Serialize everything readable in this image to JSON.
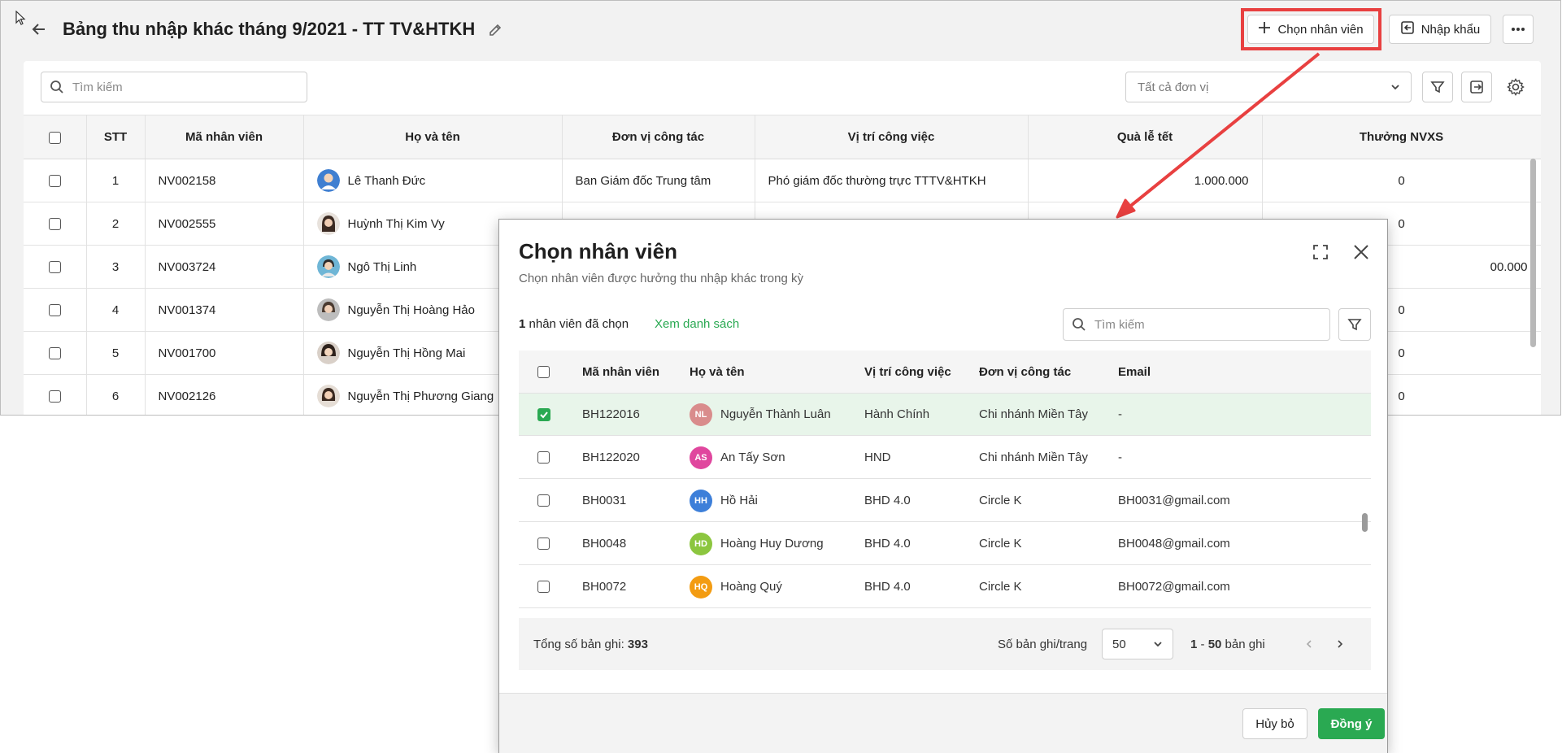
{
  "header": {
    "title": "Bảng thu nhập khác tháng 9/2021 - TT TV&HTKH",
    "choose_employee_label": "Chọn nhân viên",
    "import_label": "Nhập khẩu"
  },
  "toolbar": {
    "search_placeholder": "Tìm kiếm",
    "unit_select_value": "Tất cả đơn vị"
  },
  "bg_table": {
    "columns": [
      "STT",
      "Mã nhân viên",
      "Họ và tên",
      "Đơn vị công tác",
      "Vị trí công việc",
      "Quà lễ tết",
      "Thưởng NVXS"
    ],
    "rows": [
      {
        "stt": "1",
        "code": "NV002158",
        "name": "Lê Thanh Đức",
        "unit": "Ban Giám đốc Trung tâm",
        "position": "Phó giám đốc thường trực TTTV&HTKH",
        "gift": "1.000.000",
        "bonus": "0"
      },
      {
        "stt": "2",
        "code": "NV002555",
        "name": "Huỳnh Thị Kim Vy",
        "unit": "",
        "position": "",
        "gift": "",
        "bonus": "0"
      },
      {
        "stt": "3",
        "code": "NV003724",
        "name": "Ngô Thị Linh",
        "unit": "",
        "position": "",
        "gift": "",
        "bonus": "00.000"
      },
      {
        "stt": "4",
        "code": "NV001374",
        "name": "Nguyễn Thị Hoàng Hảo",
        "unit": "",
        "position": "",
        "gift": "",
        "bonus": "0"
      },
      {
        "stt": "5",
        "code": "NV001700",
        "name": "Nguyễn Thị Hồng Mai",
        "unit": "",
        "position": "",
        "gift": "",
        "bonus": "0"
      },
      {
        "stt": "6",
        "code": "NV002126",
        "name": "Nguyễn Thị Phương Giang",
        "unit": "",
        "position": "",
        "gift": "",
        "bonus": "0"
      }
    ]
  },
  "dialog": {
    "title": "Chọn nhân viên",
    "subtitle": "Chọn nhân viên được hưởng thu nhập khác trong kỳ",
    "selected_count": "1",
    "selected_suffix": " nhân viên đã chọn",
    "view_list_label": "Xem danh sách",
    "search_placeholder": "Tìm kiếm",
    "columns": [
      "Mã nhân viên",
      "Họ và tên",
      "Vị trí công việc",
      "Đơn vị công tác",
      "Email"
    ],
    "rows": [
      {
        "code": "BH122016",
        "initials": "NL",
        "avatar_color": "#d98c8c",
        "name": "Nguyễn Thành Luân",
        "position": "Hành Chính",
        "unit": "Chi nhánh Miền Tây",
        "email": "-",
        "checked": true
      },
      {
        "code": "BH122020",
        "initials": "AS",
        "avatar_color": "#e0479e",
        "name": "An Tấy Sơn",
        "position": "HND",
        "unit": "Chi nhánh Miền Tây",
        "email": "-",
        "checked": false
      },
      {
        "code": "BH0031",
        "initials": "HH",
        "avatar_color": "#3d7fd9",
        "name": "Hồ Hải",
        "position": "BHD 4.0",
        "unit": "Circle K",
        "email": "BH0031@gmail.com",
        "checked": false
      },
      {
        "code": "BH0048",
        "initials": "HD",
        "avatar_color": "#8cc63f",
        "name": "Hoàng Huy Dương",
        "position": "BHD 4.0",
        "unit": "Circle K",
        "email": "BH0048@gmail.com",
        "checked": false
      },
      {
        "code": "BH0072",
        "initials": "HQ",
        "avatar_color": "#f39c12",
        "name": "Hoàng Quý",
        "position": "BHD 4.0",
        "unit": "Circle K",
        "email": "BH0072@gmail.com",
        "checked": false
      }
    ],
    "pager": {
      "total_label": "Tổng số bản ghi:",
      "total_value": "393",
      "page_size_label": "Số bản ghi/trang",
      "page_size_value": "50",
      "range_start": "1",
      "range_sep": " - ",
      "range_end": "50",
      "range_suffix": " bản ghi"
    },
    "cancel_label": "Hủy bỏ",
    "ok_label": "Đồng ý"
  },
  "colors": {
    "accent_green": "#2aa952",
    "highlight_red": "#e84040"
  }
}
